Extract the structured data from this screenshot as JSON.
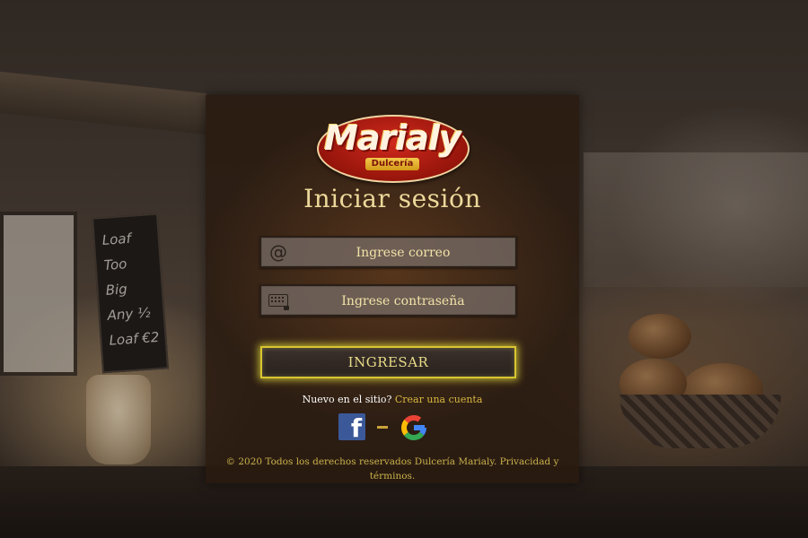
{
  "colors": {
    "accent_text": "#ECD89A",
    "button_glow": "#D8C630",
    "link": "#D8B840",
    "facebook": "#3B5998",
    "logo_red": "#C4231A"
  },
  "background": {
    "chalkboard_lines": [
      "Loaf Too",
      "Big",
      "Any ½",
      "Loaf €2"
    ]
  },
  "logo": {
    "name": "Marialy",
    "subtitle": "Dulcería"
  },
  "login": {
    "title": "Iniciar sesión",
    "email": {
      "placeholder": "Ingrese correo",
      "value": "",
      "icon": "at-icon"
    },
    "password": {
      "placeholder": "Ingrese contraseña",
      "value": "",
      "icon": "keyboard-icon"
    },
    "submit_label": "INGRESAR"
  },
  "signup": {
    "question": "Nuevo en el sitio?",
    "link": "Crear una cuenta"
  },
  "social": {
    "facebook_icon": "facebook-icon",
    "google_icon": "google-icon",
    "facebook_letter": "f",
    "google_letter": "G"
  },
  "footer": {
    "text": "© 2020 Todos los derechos reservados Dulcería Marialy.",
    "link": "Privacidad y términos."
  }
}
